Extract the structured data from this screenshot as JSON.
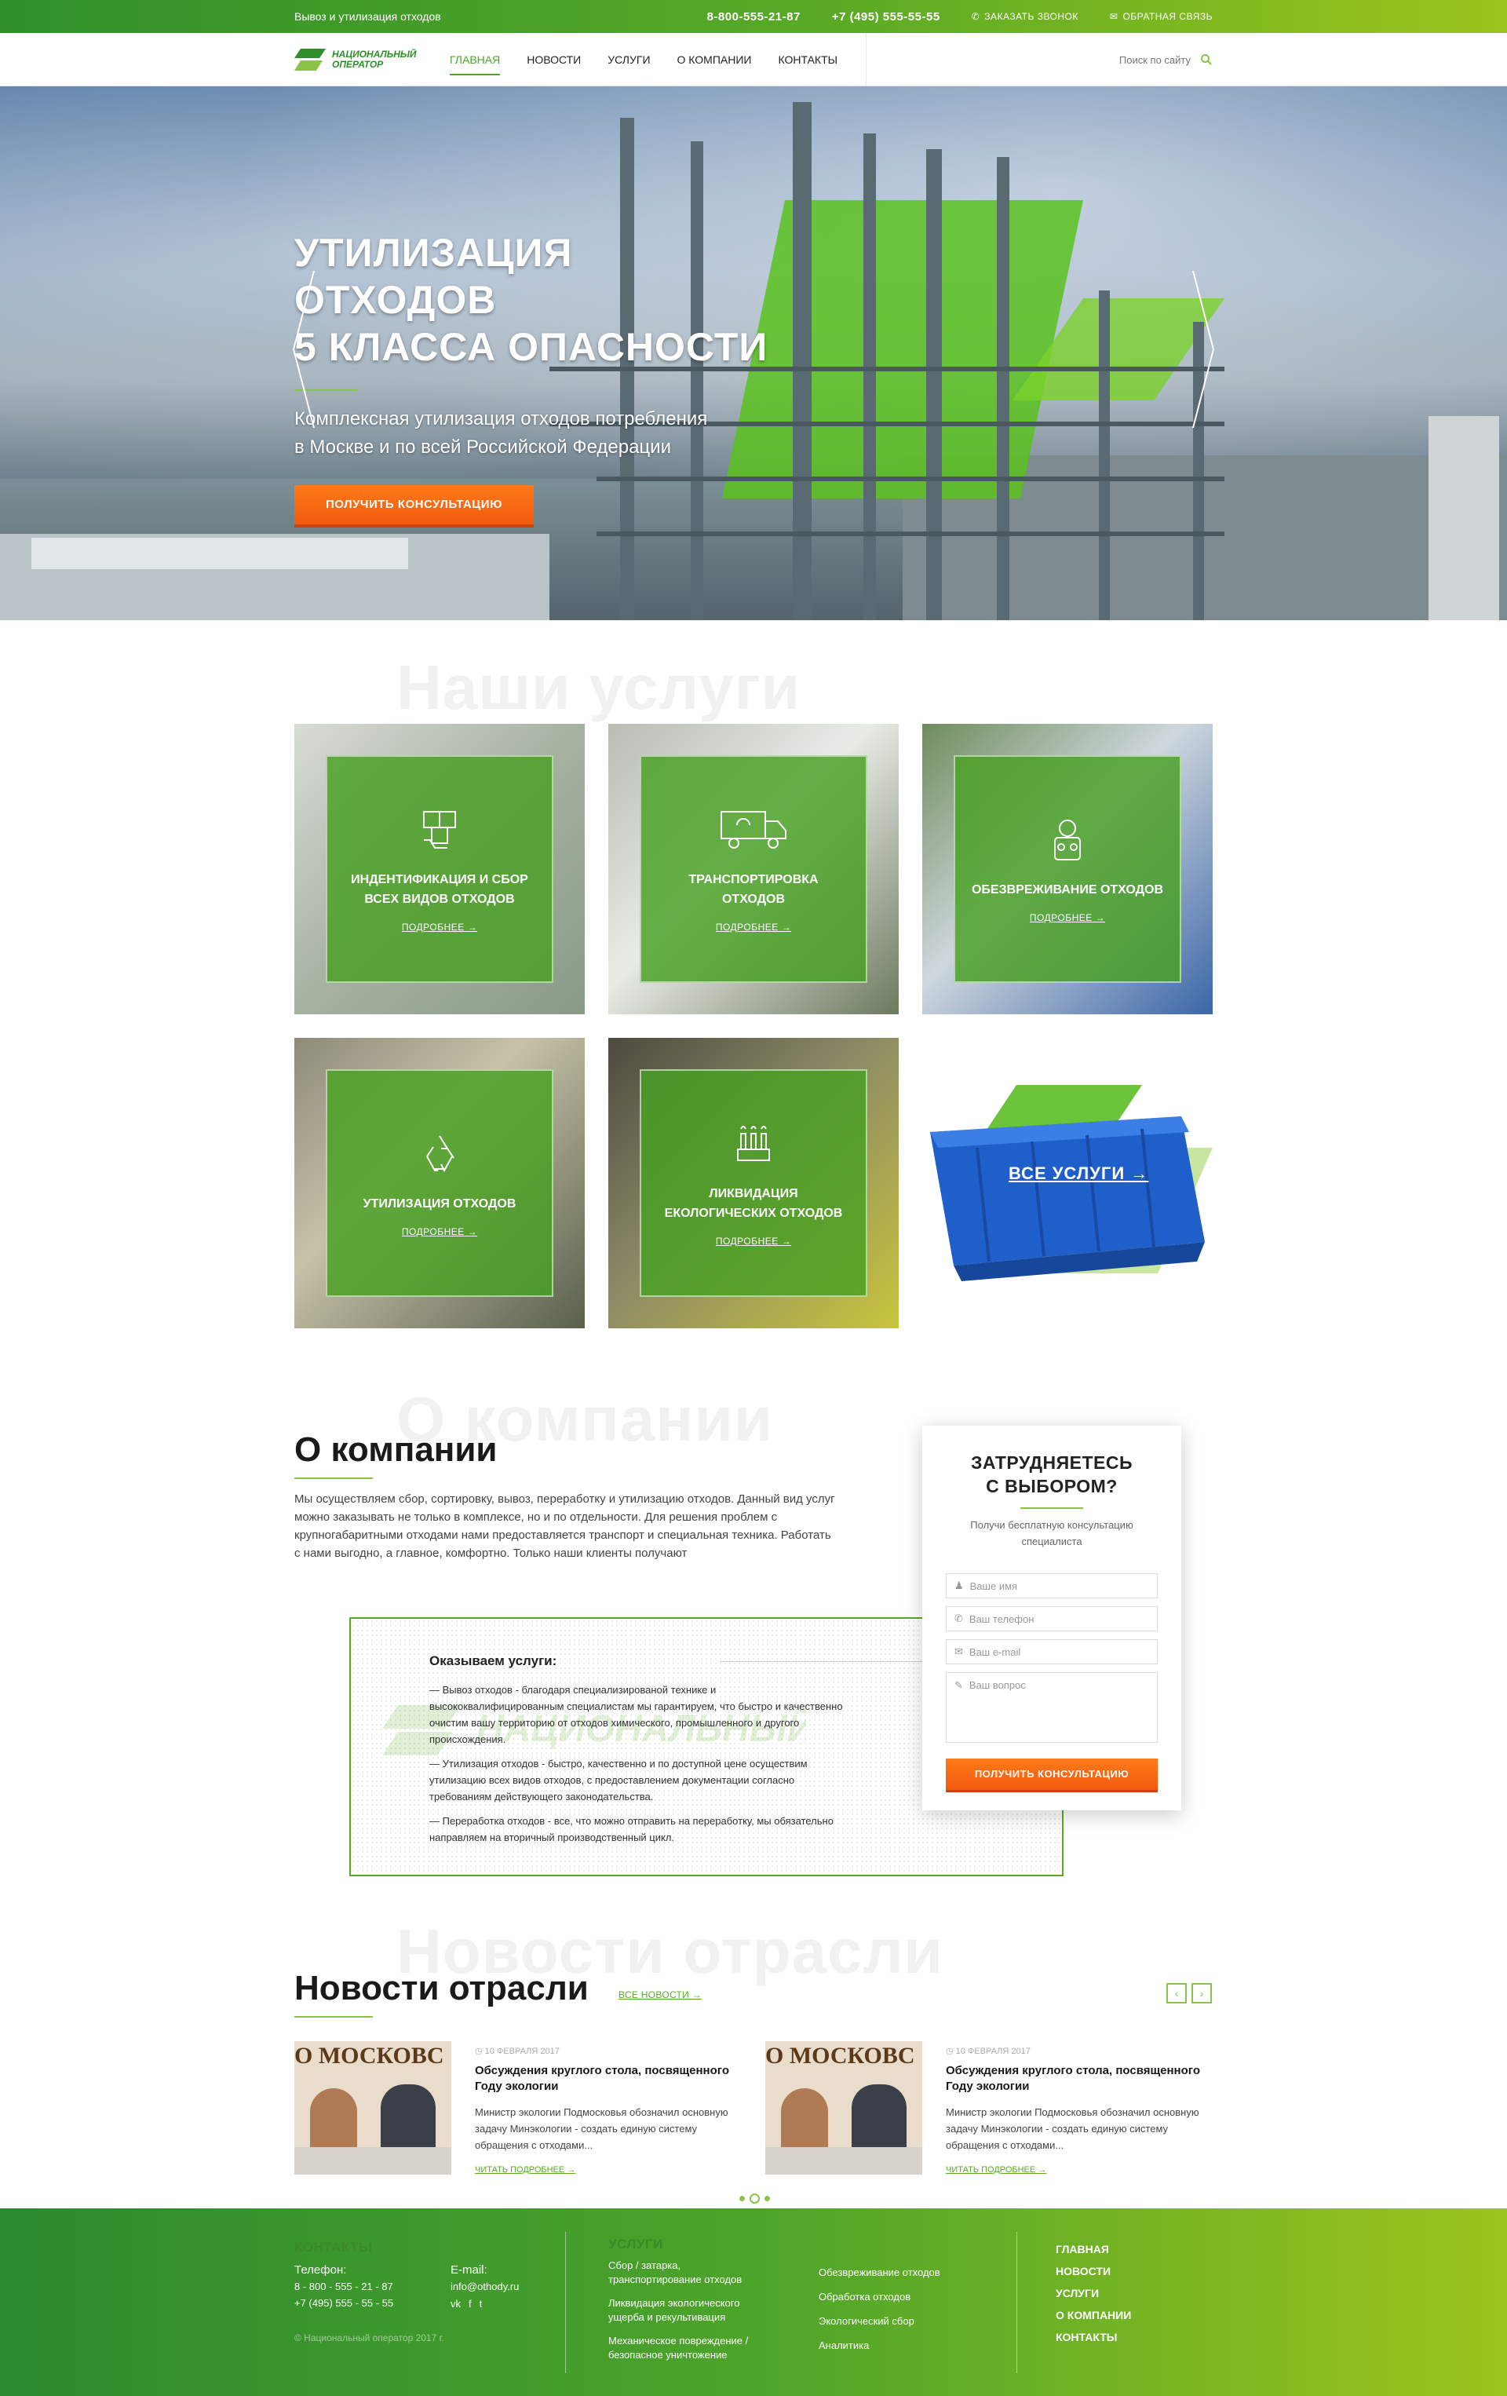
{
  "topbar": {
    "slogan": "Вывоз и утилизация отходов",
    "phone1": "8-800-555-21-87",
    "phone2": "+7 (495) 555-55-55",
    "callback": "Заказать звонок",
    "feedback": "Обратная связь"
  },
  "logo": {
    "line1": "Национальный",
    "line2": "Оператор"
  },
  "menu": [
    {
      "label": "Главная",
      "active": true
    },
    {
      "label": "Новости"
    },
    {
      "label": "Услуги"
    },
    {
      "label": "О компании"
    },
    {
      "label": "Контакты"
    }
  ],
  "search": {
    "placeholder": "Поиск по сайту"
  },
  "hero": {
    "title_line1": "Утилизация отходов",
    "title_line2": "5 класса опасности",
    "subtitle_line1": "Комплексная утилизация отходов потребления",
    "subtitle_line2": "в Москве и по всей Российской Федерации",
    "button": "Получить консультацию"
  },
  "services": {
    "ghost": "Наши услуги",
    "more_label": "Подробнее",
    "items": [
      {
        "title": "Индентификация и сбор всех видов отходов",
        "icon": "boxes-icon"
      },
      {
        "title": "Транспортировка отходов",
        "icon": "truck-icon"
      },
      {
        "title": "Обезвреживание отходов",
        "icon": "hazmat-icon"
      },
      {
        "title": "Утилизация отходов",
        "icon": "recycle-icon"
      },
      {
        "title": "Ликвидация екологических отходов",
        "icon": "factory-icon"
      }
    ],
    "all_label": "Все услуги"
  },
  "about": {
    "ghost": "О компании",
    "title": "О компании",
    "text": "Мы осуществляем сбор, сортировку, вывоз, переработку и утилизацию отходов. Данный вид услуг можно заказывать не только в комплексе, но и по отдельности. Для решения проблем с крупногабаритными отходами нами предоставляется транспорт и специальная техника. Работать с нами выгодно, а главное, комфортно. Только наши клиенты получают",
    "services_title": "Оказываем услуги:",
    "services_items": [
      "— Вывоз отходов - благодаря специализированой технике и высококвалифицированным специалистам мы гарантируем, что быстро и качественно очистим вашу территорию от отходов химического, промышленного и другого происхождения.",
      "— Утилизация отходов - быстро, качественно и по доступной цене осуществим утилизацию всех видов отходов, с предоставлением документации согласно требованиям действующего законодательства.",
      "— Переработка отходов - все, что можно отправить на переработку, мы обязательно направляем на вторичный производственный цикл."
    ]
  },
  "form": {
    "title_line1": "Затрудняетесь",
    "title_line2": "с выбором?",
    "subtitle": "Получи бесплатную консультацию специалиста",
    "name": "Ваше имя",
    "phone": "Ваш телефон",
    "email": "Ваш e-mail",
    "question": "Ваш вопрос",
    "button": "Получить консультацию"
  },
  "news": {
    "ghost": "Новости отрасли",
    "title": "Новости отрасли",
    "all": "Все новости",
    "read_more": "Читать подробнее",
    "items": [
      {
        "date": "10 февраля 2017",
        "title": "Обсуждения круглого стола, посвященного Году экологии",
        "text": "Министр экологии Подмосковья обозначил основную задачу Минэкологии - создать единую систему обращения с отходами...",
        "img_text": "О МОСКОВС"
      },
      {
        "date": "10 февраля 2017",
        "title": "Обсуждения круглого стола, посвященного Году экологии",
        "text": "Министр экологии Подмосковья обозначил основную задачу Минэкологии - создать единую систему обращения с отходами...",
        "img_text": "О МОСКОВС"
      }
    ]
  },
  "footer": {
    "contacts_title": "Контакты",
    "phone_label": "Телефон:",
    "phone1": "8 - 800 - 555 - 21 - 87",
    "phone2": "+7 (495) 555 - 55 - 55",
    "email_label": "E-mail:",
    "email": "info@othody.ru",
    "copyright": "© Национальный оператор 2017 г.",
    "services_title": "Услуги",
    "services_col1": [
      "Сбор / затарка, транспортирование отходов",
      "Ликвидация экологического ущерба и рекультивация",
      "Механическое повреждение / безопасное уничтожение"
    ],
    "services_col2": [
      "Обезвреживание отходов",
      "Обработка отходов",
      "Экологический сбор",
      "Аналитика"
    ],
    "links": [
      "Главная",
      "Новости",
      "Услуги",
      "О компании",
      "Контакты"
    ]
  },
  "colors": {
    "green": "#4aa52a",
    "lime": "#9cc41c",
    "orange": "#f15a0d"
  }
}
